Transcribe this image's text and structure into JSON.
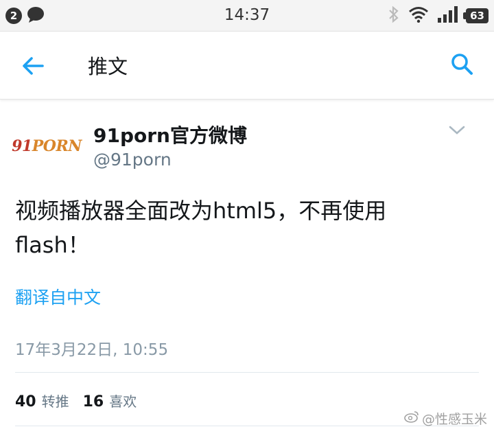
{
  "status_bar": {
    "notification_count": "2",
    "time": "14:37",
    "battery": "63",
    "icons": [
      "chat-bubble-icon",
      "bluetooth-icon",
      "wifi-icon",
      "signal-icon",
      "battery-icon"
    ]
  },
  "app_bar": {
    "title": "推文",
    "back_icon": "arrow-left-icon",
    "search_icon": "search-icon"
  },
  "tweet": {
    "display_name": "91porn官方微博",
    "handle": "@91porn",
    "avatar_text_a": "91",
    "avatar_text_b": "PORN",
    "text": "视频播放器全面改为html5，不再使用flash！",
    "translate_label": "翻译自中文",
    "timestamp": "17年3月22日, 10:55",
    "retweets_count": "40",
    "retweets_label": "转推",
    "likes_count": "16",
    "likes_label": "喜欢"
  },
  "watermark": {
    "text": "@性感玉米"
  },
  "colors": {
    "accent": "#1da1f2",
    "text": "#14171a",
    "secondary": "#657786"
  }
}
